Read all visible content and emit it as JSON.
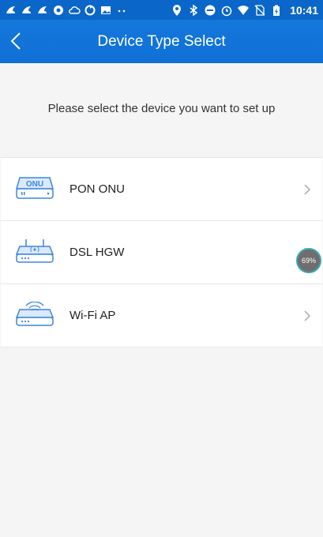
{
  "status_bar": {
    "time": "10:41",
    "left_icons": [
      "uc-browser-icon",
      "uc-browser-icon",
      "uc-browser-icon",
      "chat-icon",
      "cloud-icon",
      "sync-icon",
      "image-icon",
      "more-dots-icon"
    ],
    "right_icons": [
      "location-icon",
      "bluetooth-icon",
      "do-not-disturb-icon",
      "alarm-icon",
      "wifi-icon",
      "no-sim-icon",
      "battery-icon"
    ]
  },
  "header": {
    "title": "Device Type Select",
    "back_icon": "chevron-left-icon"
  },
  "prompt": "Please select the device you want to set up",
  "devices": [
    {
      "label": "PON ONU",
      "icon": "pon-onu-icon",
      "icon_text": "ONU"
    },
    {
      "label": "DSL HGW",
      "icon": "dsl-router-icon"
    },
    {
      "label": "Wi-Fi AP",
      "icon": "wifi-ap-icon"
    }
  ],
  "floating_widget": {
    "text": "69%"
  },
  "colors": {
    "statusbar": "#0a66c8",
    "appbar": "#1070d6",
    "background": "#f5f5f5",
    "icon_blue": "#3b86e0",
    "accent_ring": "#3aa9b2"
  }
}
